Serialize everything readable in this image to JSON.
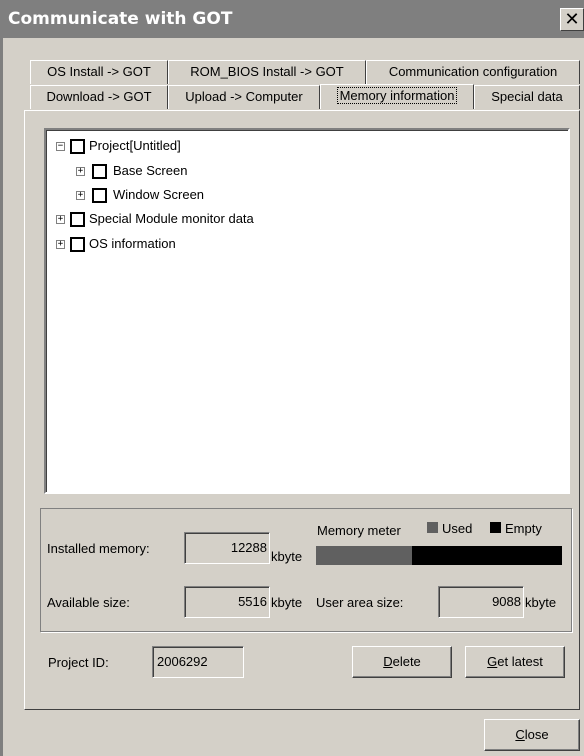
{
  "window": {
    "title": "Communicate with GOT",
    "close_glyph": "✕"
  },
  "tabs_row1": [
    {
      "label": "OS Install -> GOT"
    },
    {
      "label": "ROM_BIOS Install -> GOT"
    },
    {
      "label": "Communication configuration"
    }
  ],
  "tabs_row2": [
    {
      "label": "Download -> GOT"
    },
    {
      "label": "Upload -> Computer"
    },
    {
      "label": "Memory information",
      "active": true
    },
    {
      "label": "Special data"
    }
  ],
  "tree": [
    {
      "label": "Project[Untitled]",
      "expander": "−",
      "level": 0
    },
    {
      "label": "Base Screen",
      "expander": "+",
      "level": 1
    },
    {
      "label": "Window Screen",
      "expander": "+",
      "level": 1
    },
    {
      "label": "Special Module monitor data",
      "expander": "+",
      "level": 0
    },
    {
      "label": "OS information",
      "expander": "+",
      "level": 0
    }
  ],
  "memory": {
    "installed_label": "Installed memory:",
    "installed_value": "12288",
    "installed_unit": "kbyte",
    "available_label": "Available size:",
    "available_value": "5516",
    "available_unit": "kbyte",
    "meter_label": "Memory meter",
    "legend_used": "Used",
    "legend_empty": "Empty",
    "used_fraction": 0.39,
    "user_area_label": "User area size:",
    "user_area_value": "9088",
    "user_area_unit": "kbyte",
    "colors": {
      "used": "#606060",
      "empty": "#000000"
    }
  },
  "project": {
    "id_label": "Project ID:",
    "id_value": "2006292"
  },
  "buttons": {
    "delete_key": "D",
    "delete_rest": "elete",
    "get_latest_key": "G",
    "get_latest_rest": "et latest",
    "close_key": "C",
    "close_rest": "lose"
  }
}
